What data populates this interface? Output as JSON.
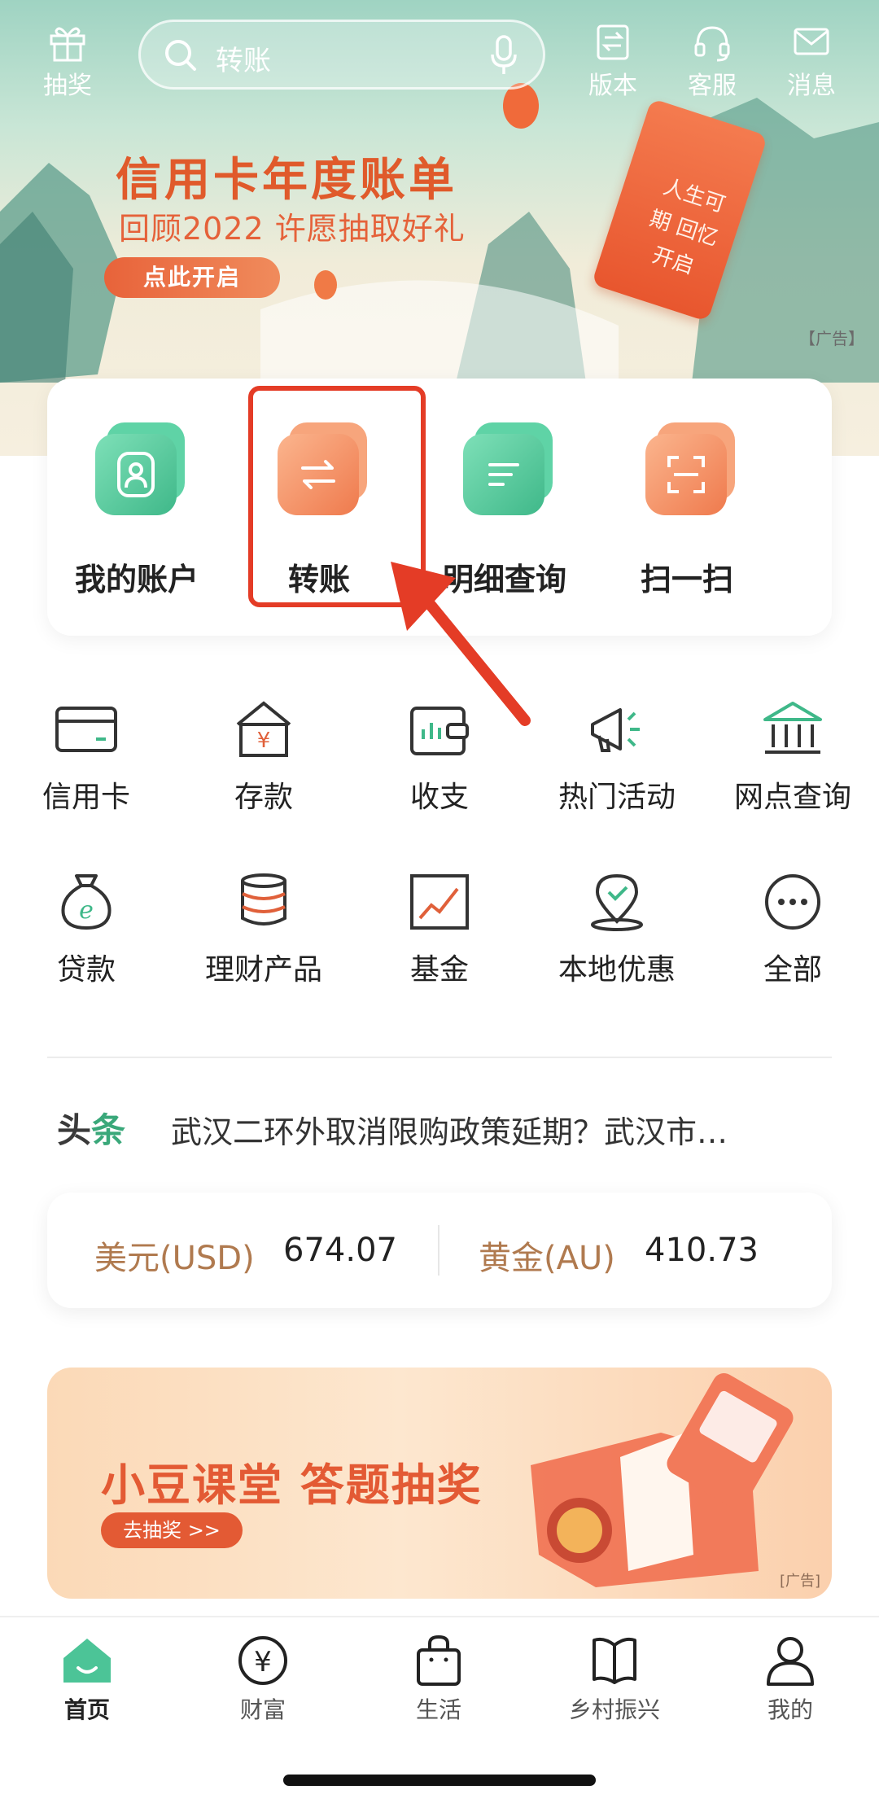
{
  "topbar": {
    "lottery_label": "抽奖",
    "search_placeholder": "转账",
    "version_label": "版本",
    "service_label": "客服",
    "message_label": "消息"
  },
  "banner": {
    "title": "信用卡年度账单",
    "subtitle": "回顾2022 许愿抽取好礼",
    "button_label": "点此开启",
    "scroll_text": "人生可期 回忆开启",
    "ad_tag": "【广告】"
  },
  "quick_actions": [
    {
      "label": "我的账户",
      "icon": "user-icon",
      "color": "#4cc497"
    },
    {
      "label": "转账",
      "icon": "transfer-icon",
      "color": "#f2875a"
    },
    {
      "label": "明细查询",
      "icon": "list-icon",
      "color": "#4cc497"
    },
    {
      "label": "扫一扫",
      "icon": "scan-icon",
      "color": "#f2875a"
    }
  ],
  "services_row1": [
    {
      "label": "信用卡",
      "icon": "credit-card-icon"
    },
    {
      "label": "存款",
      "icon": "deposit-icon"
    },
    {
      "label": "收支",
      "icon": "wallet-icon"
    },
    {
      "label": "热门活动",
      "icon": "megaphone-icon"
    },
    {
      "label": "网点查询",
      "icon": "bank-icon"
    }
  ],
  "services_row2": [
    {
      "label": "贷款",
      "icon": "loan-bag-icon"
    },
    {
      "label": "理财产品",
      "icon": "coin-stack-icon"
    },
    {
      "label": "基金",
      "icon": "fund-chart-icon"
    },
    {
      "label": "本地优惠",
      "icon": "location-icon"
    },
    {
      "label": "全部",
      "icon": "more-icon"
    }
  ],
  "headline": {
    "tag_part1": "头",
    "tag_part2": "条",
    "text": "武汉二环外取消限购政策延期？武汉市…"
  },
  "rates": {
    "usd_label": "美元(USD)",
    "usd_value": "674.07",
    "gold_label": "黄金(AU)",
    "gold_value": "410.73"
  },
  "promo2": {
    "title": "小豆课堂 答题抽奖",
    "button_label": "去抽奖 >>",
    "ad_tag": "[广告]"
  },
  "bottom_nav": [
    {
      "label": "首页",
      "icon": "home-icon",
      "active": true
    },
    {
      "label": "财富",
      "icon": "yen-icon",
      "active": false
    },
    {
      "label": "生活",
      "icon": "shopping-bag-icon",
      "active": false
    },
    {
      "label": "乡村振兴",
      "icon": "book-icon",
      "active": false
    },
    {
      "label": "我的",
      "icon": "person-icon",
      "active": false
    }
  ],
  "colors": {
    "accent_green": "#4cc497",
    "accent_orange": "#f2875a",
    "highlight_red": "#e43c26"
  }
}
